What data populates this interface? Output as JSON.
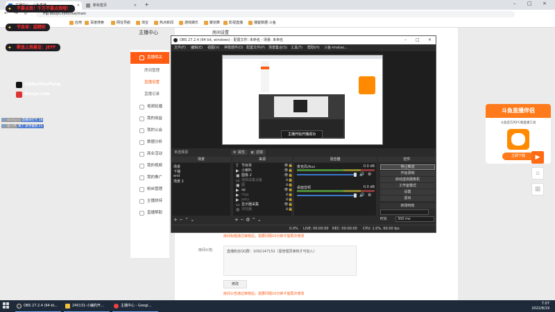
{
  "browser": {
    "tabs": [
      {
        "label": "主播中心 - 斗鱼直播",
        "active": true
      },
      {
        "label": "新标签页",
        "active": false
      }
    ],
    "url": "mp.douyu.com/live/main",
    "bookmarks": [
      "应用",
      "百度搜索",
      "网址导航",
      "淘宝",
      "热点新闻",
      "游戏娱乐",
      "聚划算",
      "影视直播",
      "播客数据-斗鱼"
    ]
  },
  "overlay": {
    "banners": [
      "不要点我！千万不要点我哦！",
      "节目单：超精彩",
      "歌迷上周最佳：JEFF"
    ],
    "socials": [
      "@AlexXiaoFeng",
      "douyu.com"
    ],
    "chat": [
      {
        "name": "dandyco",
        "text": "直播间打卡 18"
      },
      {
        "name": "路人甲",
        "text": "来了 新手报到 21"
      }
    ]
  },
  "page": {
    "sidebar_title": "主播中心",
    "content_title": "房间设置",
    "sidebar": [
      {
        "label": "直播相关",
        "active": true,
        "type": "main"
      },
      {
        "label": "房间管理",
        "active": false,
        "type": "sub"
      },
      {
        "label": "直播设置",
        "active": true,
        "type": "sub"
      },
      {
        "label": "直播记录",
        "active": false,
        "type": "sub"
      },
      {
        "label": "视频轮播",
        "active": false,
        "type": "main"
      },
      {
        "label": "我的收益",
        "active": false,
        "type": "main"
      },
      {
        "label": "我的公会",
        "active": false,
        "type": "main"
      },
      {
        "label": "数据分析",
        "active": false,
        "type": "main"
      },
      {
        "label": "商业活动",
        "active": false,
        "type": "main"
      },
      {
        "label": "我的视频",
        "active": false,
        "type": "main"
      },
      {
        "label": "我的推广",
        "active": false,
        "type": "main"
      },
      {
        "label": "粉丝管理",
        "active": false,
        "type": "main"
      },
      {
        "label": "主播扶持",
        "active": false,
        "type": "main"
      },
      {
        "label": "直播帮助",
        "active": false,
        "type": "main"
      }
    ],
    "error_1": "房间标题通过审核后，需要间隔10分钟才能再次修改",
    "notice_label": "房间公告:",
    "notice_text": "直播粉丝QQ群：1092147152（需管理员审核才可加入）",
    "modify_label": "修改",
    "error_2": "房间公告通过审核后，需要间隔10分钟才能再次修改"
  },
  "obs": {
    "title": "OBS 27.2.4 (64 bit, windows) - 配置文件: 未命名 - 场景: 未命名",
    "menu": [
      "文件(F)",
      "编辑(E)",
      "视图(V)",
      "停靠部件(D)",
      "配置文件(P)",
      "场景集合(S)",
      "工具(T)",
      "帮助(H)",
      "斗鱼-imatao..."
    ],
    "start_dialog": "主播开始开播成功",
    "no_source": "未选择源",
    "ctx_props": "属性",
    "ctx_filters": "滤镜",
    "docks": {
      "scenes": "场景",
      "sources": "来源",
      "mixer": "混音器",
      "controls": "控件"
    },
    "scenes": [
      "场景",
      "下播",
      "end",
      "场景 2"
    ],
    "sources": [
      {
        "label": "节目单",
        "dim": false
      },
      {
        "label": "小喇叭",
        "dim": false
      },
      {
        "label": "图像 2",
        "dim": false
      },
      {
        "label": "视频采集设备",
        "dim": true
      },
      {
        "label": "图",
        "dim": true
      },
      {
        "label": "sp",
        "dim": false
      },
      {
        "label": "rtqq",
        "dim": true
      },
      {
        "label": "paty",
        "dim": true
      },
      {
        "label": "显示器采集",
        "dim": false
      },
      {
        "label": "浏览器",
        "dim": true
      }
    ],
    "mixer": [
      {
        "name": "麦克风/Aux",
        "db": "0.0 dB"
      },
      {
        "name": "桌面音频",
        "db": "0.0 dB"
      }
    ],
    "controls": [
      "停止推流",
      "开始录制",
      "启动虚拟摄像机",
      "工作室模式",
      "设置",
      "退出"
    ],
    "transition_head": "转场特效",
    "duration_label": "时长",
    "duration_value": "300 ms",
    "status": {
      "drop": "0.0%",
      "live": "LIVE: 00:00:00",
      "rec": "REC: 00:00:00",
      "cpu": "CPU: 1.0%, 60.00 fps"
    }
  },
  "promo": {
    "head": "斗鱼直播伴侣",
    "sub": "斗鱼官方的PC端直播工具",
    "download": "立即下载"
  },
  "taskbar": {
    "items": [
      "OBS 27.2.4 (64-bi...",
      "240131-小编的开...",
      "主播中心 - Googl..."
    ],
    "time": "7:07",
    "date": "2022/8/19"
  },
  "colors": {
    "accent": "#ff5b12",
    "obs_bg": "#2b2b2b",
    "taskbar": "#1e2a3a"
  }
}
